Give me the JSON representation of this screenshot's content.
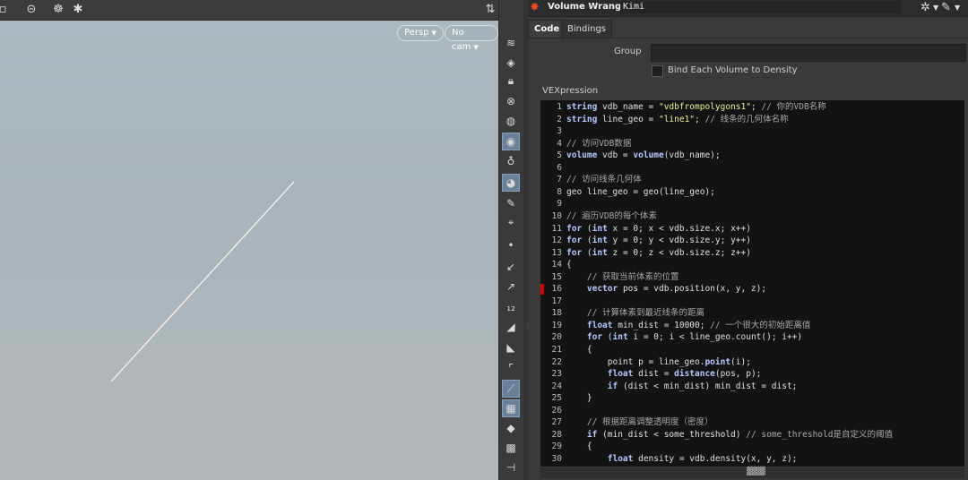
{
  "viewport": {
    "persp_label": "Persp",
    "cam_label": "No cam"
  },
  "panel": {
    "node_type": "Volume Wrangle",
    "node_name": "Kimi",
    "tabs": [
      {
        "label": "Code"
      },
      {
        "label": "Bindings"
      }
    ],
    "group_label": "Group",
    "group_value": "",
    "bind_label": "Bind Each Volume to Density",
    "vex_label": "VEXpression"
  },
  "code_lines": [
    {
      "n": "1",
      "t": [
        [
          "kw",
          "string"
        ],
        [
          "p",
          " vdb_name = "
        ],
        [
          "st",
          "\"vdbfrompolygons1\""
        ],
        [
          "p",
          "; "
        ],
        [
          "cm",
          "// 你的VDB名称"
        ]
      ]
    },
    {
      "n": "2",
      "t": [
        [
          "kw",
          "string"
        ],
        [
          "p",
          " line_geo = "
        ],
        [
          "st",
          "\"line1\""
        ],
        [
          "p",
          "; "
        ],
        [
          "cm",
          "// 线条的几何体名称"
        ]
      ]
    },
    {
      "n": "3",
      "t": []
    },
    {
      "n": "4",
      "t": [
        [
          "cm",
          "// 访问VDB数据"
        ]
      ]
    },
    {
      "n": "5",
      "t": [
        [
          "kw",
          "volume"
        ],
        [
          "p",
          " vdb = "
        ],
        [
          "kw",
          "volume"
        ],
        [
          "p",
          "(vdb_name);"
        ]
      ]
    },
    {
      "n": "6",
      "t": []
    },
    {
      "n": "7",
      "t": [
        [
          "cm",
          "// 访问线条几何体"
        ]
      ]
    },
    {
      "n": "8",
      "t": [
        [
          "p",
          "geo line_geo = geo(line_geo);"
        ]
      ]
    },
    {
      "n": "9",
      "t": []
    },
    {
      "n": "10",
      "t": [
        [
          "cm",
          "// 遍历VDB的每个体素"
        ]
      ]
    },
    {
      "n": "11",
      "t": [
        [
          "kw",
          "for"
        ],
        [
          "p",
          " ("
        ],
        [
          "kw",
          "int"
        ],
        [
          "p",
          " x = 0; x < vdb.size.x; x++)"
        ]
      ]
    },
    {
      "n": "12",
      "t": [
        [
          "kw",
          "for"
        ],
        [
          "p",
          " ("
        ],
        [
          "kw",
          "int"
        ],
        [
          "p",
          " y = 0; y < vdb.size.y; y++)"
        ]
      ]
    },
    {
      "n": "13",
      "t": [
        [
          "kw",
          "for"
        ],
        [
          "p",
          " ("
        ],
        [
          "kw",
          "int"
        ],
        [
          "p",
          " z = 0; z < vdb.size.z; z++)"
        ]
      ]
    },
    {
      "n": "14",
      "t": [
        [
          "p",
          "{"
        ]
      ]
    },
    {
      "n": "15",
      "t": [
        [
          "p",
          "    "
        ],
        [
          "cm",
          "// 获取当前体素的位置"
        ]
      ]
    },
    {
      "n": "16",
      "t": [
        [
          "p",
          "    "
        ],
        [
          "kw",
          "vector"
        ],
        [
          "p",
          " pos = vdb.position(x, y, z);"
        ]
      ]
    },
    {
      "n": "17",
      "t": []
    },
    {
      "n": "18",
      "t": [
        [
          "p",
          "    "
        ],
        [
          "cm",
          "// 计算体素到最近线条的距离"
        ]
      ]
    },
    {
      "n": "19",
      "t": [
        [
          "p",
          "    "
        ],
        [
          "kw",
          "float"
        ],
        [
          "p",
          " min_dist = 10000; "
        ],
        [
          "cm",
          "// 一个很大的初始距离值"
        ]
      ]
    },
    {
      "n": "20",
      "t": [
        [
          "p",
          "    "
        ],
        [
          "kw",
          "for"
        ],
        [
          "p",
          " ("
        ],
        [
          "kw",
          "int"
        ],
        [
          "p",
          " i = 0; i < line_geo.count(); i++)"
        ]
      ]
    },
    {
      "n": "21",
      "t": [
        [
          "p",
          "    {"
        ]
      ]
    },
    {
      "n": "22",
      "t": [
        [
          "p",
          "        point p = line_geo."
        ],
        [
          "kw",
          "point"
        ],
        [
          "p",
          "(i);"
        ]
      ]
    },
    {
      "n": "23",
      "t": [
        [
          "p",
          "        "
        ],
        [
          "kw",
          "float"
        ],
        [
          "p",
          " dist = "
        ],
        [
          "kw",
          "distance"
        ],
        [
          "p",
          "(pos, p);"
        ]
      ]
    },
    {
      "n": "24",
      "t": [
        [
          "p",
          "        "
        ],
        [
          "kw",
          "if"
        ],
        [
          "p",
          " (dist < min_dist) min_dist = dist;"
        ]
      ]
    },
    {
      "n": "25",
      "t": [
        [
          "p",
          "    }"
        ]
      ]
    },
    {
      "n": "26",
      "t": []
    },
    {
      "n": "27",
      "t": [
        [
          "p",
          "    "
        ],
        [
          "cm",
          "// 根据距离调整透明度（密度）"
        ]
      ]
    },
    {
      "n": "28",
      "t": [
        [
          "p",
          "    "
        ],
        [
          "kw",
          "if"
        ],
        [
          "p",
          " (min_dist < some_threshold) "
        ],
        [
          "cm",
          "// some_threshold是自定义的阈值"
        ]
      ]
    },
    {
      "n": "29",
      "t": [
        [
          "p",
          "    {"
        ]
      ]
    },
    {
      "n": "30",
      "t": [
        [
          "p",
          "        "
        ],
        [
          "kw",
          "float"
        ],
        [
          "p",
          " density = vdb.density(x, y, z);"
        ]
      ]
    }
  ]
}
